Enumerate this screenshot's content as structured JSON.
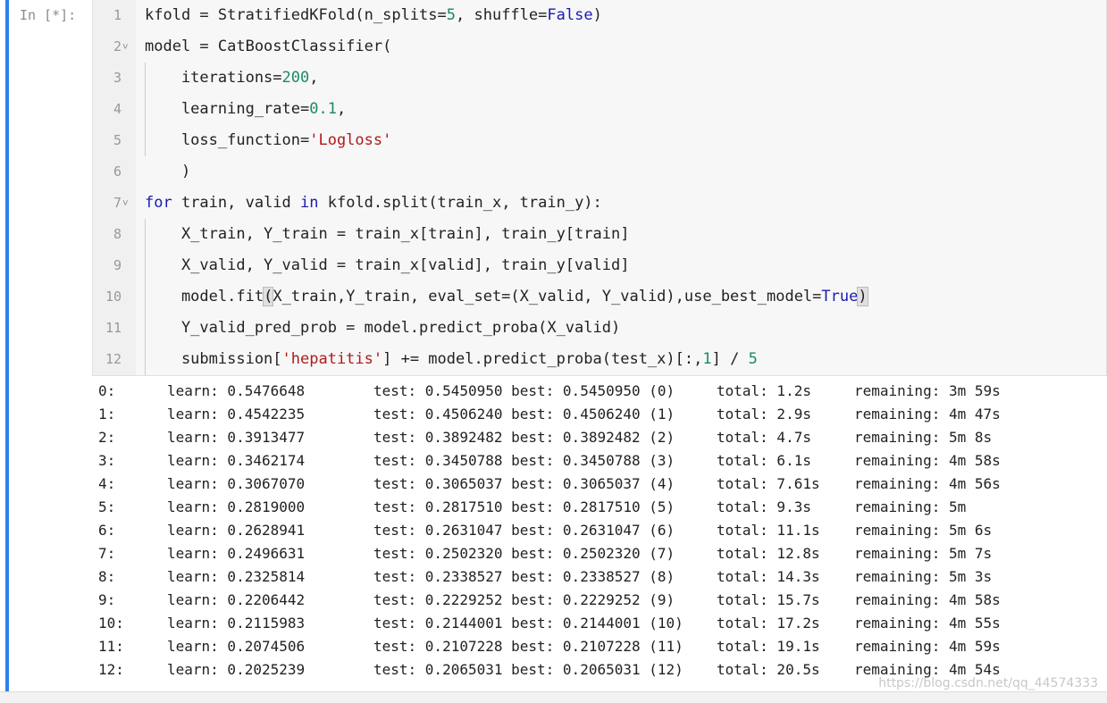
{
  "prompt": "In [*]:",
  "code_lines": [
    {
      "n": "1",
      "fold": "",
      "html": "kfold = StratifiedKFold(n_splits=<span class=\"num\">5</span>, shuffle=<span class=\"bool\">False</span>)"
    },
    {
      "n": "2",
      "fold": "v",
      "html": "model = CatBoostClassifier("
    },
    {
      "n": "3",
      "fold": "",
      "html": "    iterations=<span class=\"num\">200</span>,"
    },
    {
      "n": "4",
      "fold": "",
      "html": "    learning_rate=<span class=\"num\">0.1</span>,"
    },
    {
      "n": "5",
      "fold": "",
      "html": "    loss_function=<span class=\"str\">'Logloss'</span>"
    },
    {
      "n": "6",
      "fold": "",
      "html": "    )"
    },
    {
      "n": "7",
      "fold": "v",
      "html": "<span class=\"kw\">for</span> train, valid <span class=\"kw\">in</span> kfold.split(train_x, train_y):"
    },
    {
      "n": "8",
      "fold": "",
      "html": "    X_train, Y_train = train_x[train], train_y[train]"
    },
    {
      "n": "9",
      "fold": "",
      "html": "    X_valid, Y_valid = train_x[valid], train_y[valid]"
    },
    {
      "n": "10",
      "fold": "",
      "html": "    model.fit<span class=\"paren-hl\">(</span>X_train,Y_train, eval_set=(X_valid, Y_valid),use_best_model=<span class=\"bool\">True</span><span class=\"paren-hl\">)</span>"
    },
    {
      "n": "11",
      "fold": "",
      "html": "    Y_valid_pred_prob = model.predict_proba(X_valid)"
    },
    {
      "n": "12",
      "fold": "",
      "html": "    submission[<span class=\"str\">'hepatitis'</span>] += model.predict_proba(test_x)[:,<span class=\"num\">1</span>] / <span class=\"num\">5</span>"
    }
  ],
  "output": [
    {
      "idx": "0:",
      "learn": "learn: 0.5476648",
      "test": "test: 0.5450950 best: 0.5450950 (0)",
      "total": "total: 1.2s",
      "remaining": "remaining: 3m 59s"
    },
    {
      "idx": "1:",
      "learn": "learn: 0.4542235",
      "test": "test: 0.4506240 best: 0.4506240 (1)",
      "total": "total: 2.9s",
      "remaining": "remaining: 4m 47s"
    },
    {
      "idx": "2:",
      "learn": "learn: 0.3913477",
      "test": "test: 0.3892482 best: 0.3892482 (2)",
      "total": "total: 4.7s",
      "remaining": "remaining: 5m 8s"
    },
    {
      "idx": "3:",
      "learn": "learn: 0.3462174",
      "test": "test: 0.3450788 best: 0.3450788 (3)",
      "total": "total: 6.1s",
      "remaining": "remaining: 4m 58s"
    },
    {
      "idx": "4:",
      "learn": "learn: 0.3067070",
      "test": "test: 0.3065037 best: 0.3065037 (4)",
      "total": "total: 7.61s",
      "remaining": "remaining: 4m 56s"
    },
    {
      "idx": "5:",
      "learn": "learn: 0.2819000",
      "test": "test: 0.2817510 best: 0.2817510 (5)",
      "total": "total: 9.3s",
      "remaining": "remaining: 5m"
    },
    {
      "idx": "6:",
      "learn": "learn: 0.2628941",
      "test": "test: 0.2631047 best: 0.2631047 (6)",
      "total": "total: 11.1s",
      "remaining": "remaining: 5m 6s"
    },
    {
      "idx": "7:",
      "learn": "learn: 0.2496631",
      "test": "test: 0.2502320 best: 0.2502320 (7)",
      "total": "total: 12.8s",
      "remaining": "remaining: 5m 7s"
    },
    {
      "idx": "8:",
      "learn": "learn: 0.2325814",
      "test": "test: 0.2338527 best: 0.2338527 (8)",
      "total": "total: 14.3s",
      "remaining": "remaining: 5m 3s"
    },
    {
      "idx": "9:",
      "learn": "learn: 0.2206442",
      "test": "test: 0.2229252 best: 0.2229252 (9)",
      "total": "total: 15.7s",
      "remaining": "remaining: 4m 58s"
    },
    {
      "idx": "10:",
      "learn": "learn: 0.2115983",
      "test": "test: 0.2144001 best: 0.2144001 (10)",
      "total": "total: 17.2s",
      "remaining": "remaining: 4m 55s"
    },
    {
      "idx": "11:",
      "learn": "learn: 0.2074506",
      "test": "test: 0.2107228 best: 0.2107228 (11)",
      "total": "total: 19.1s",
      "remaining": "remaining: 4m 59s"
    },
    {
      "idx": "12:",
      "learn": "learn: 0.2025239",
      "test": "test: 0.2065031 best: 0.2065031 (12)",
      "total": "total: 20.5s",
      "remaining": "remaining: 4m 54s"
    }
  ],
  "watermark": "https://blog.csdn.net/qq_44574333",
  "colors": {
    "cell_bar": "#2f80ed",
    "keyword": "#1a1ab0",
    "number": "#1a8a6a",
    "string": "#b01a1a"
  }
}
